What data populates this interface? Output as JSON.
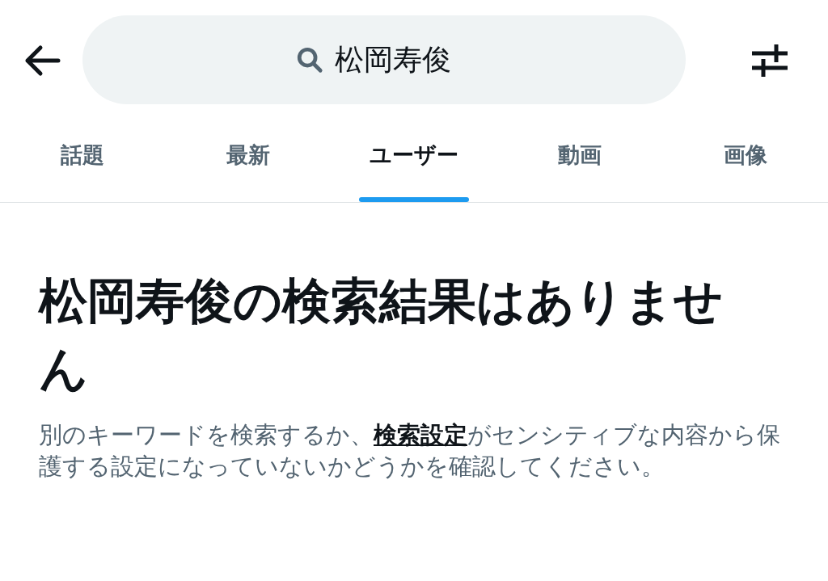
{
  "search": {
    "value": "松岡寿俊"
  },
  "tabs": [
    {
      "label": "話題",
      "selected": false
    },
    {
      "label": "最新",
      "selected": false
    },
    {
      "label": "ユーザー",
      "selected": true
    },
    {
      "label": "動画",
      "selected": false
    },
    {
      "label": "画像",
      "selected": false
    }
  ],
  "empty_state": {
    "heading": "松岡寿俊の検索結果はありません",
    "message_before": "別のキーワードを検索するか、",
    "link": "検索設定",
    "message_after": "がセンシティブな内容から保護する設定になっていないかどうかを確認してください。"
  }
}
